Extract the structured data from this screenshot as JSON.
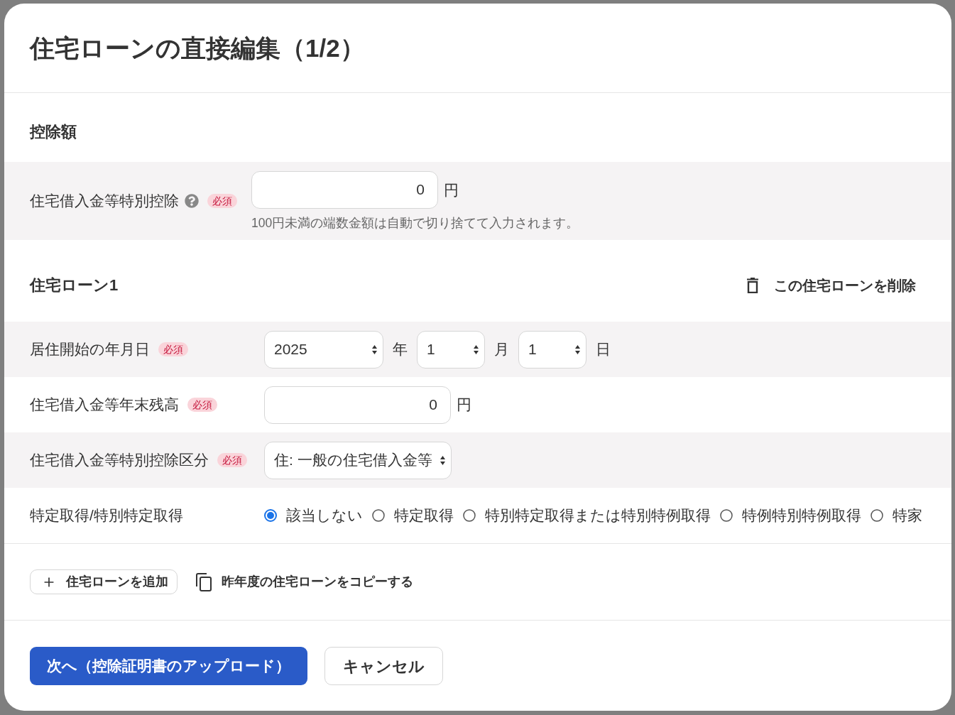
{
  "dialog": {
    "title": "住宅ローンの直接編集（1/2）"
  },
  "deduction": {
    "heading": "控除額",
    "field": {
      "label": "住宅借入金等特別控除",
      "help": true,
      "badge": "必須",
      "value": "0",
      "unit": "円",
      "hint": "100円未満の端数金額は自動で切り捨てて入力されます。"
    }
  },
  "loans": [
    {
      "heading": "住宅ローン1",
      "delete_button": "この住宅ローンを削除",
      "rows": [
        {
          "kind": "date",
          "label": "居住開始の年月日",
          "badge": "必須",
          "parts": [
            {
              "value": "2025",
              "unit": "年"
            },
            {
              "value": "1",
              "unit": "月"
            },
            {
              "value": "1",
              "unit": "日"
            }
          ]
        },
        {
          "kind": "amount",
          "label": "住宅借入金等年末残高",
          "badge": "必須",
          "value": "0",
          "unit": "円"
        },
        {
          "kind": "select",
          "label": "住宅借入金等特別控除区分",
          "badge": "必須",
          "value": "住: 一般の住宅借入金等"
        },
        {
          "kind": "radio",
          "label": "特定取得/特別特定取得",
          "options": [
            {
              "label": "該当しない",
              "selected": true
            },
            {
              "label": "特定取得",
              "selected": false
            },
            {
              "label": "特別特定取得または特別特例取得",
              "selected": false
            },
            {
              "label": "特例特別特例取得",
              "selected": false
            },
            {
              "label": "特家",
              "selected": false
            }
          ]
        }
      ]
    }
  ],
  "actions": {
    "add_button": "住宅ローンを追加",
    "copy_link": "昨年度の住宅ローンをコピーする"
  },
  "footer": {
    "next_button": "次へ（控除証明書のアップロード）",
    "cancel_button": "キャンセル"
  }
}
